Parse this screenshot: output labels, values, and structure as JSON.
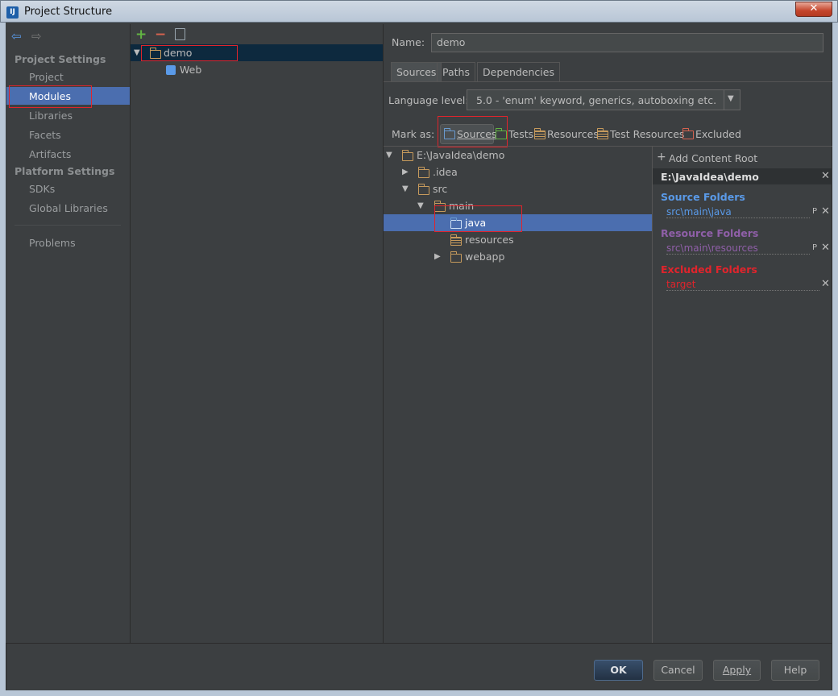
{
  "window": {
    "title": "Project Structure",
    "app_icon": "intellij-icon"
  },
  "sidebar": {
    "categories": [
      "Project Settings",
      "Platform Settings"
    ],
    "items": [
      "Project",
      "Modules",
      "Libraries",
      "Facets",
      "Artifacts",
      "SDKs",
      "Global Libraries",
      "Problems"
    ],
    "selected": "Modules"
  },
  "modules_tree": {
    "root": "demo",
    "child": "Web"
  },
  "name_field": {
    "label": "Name:",
    "value": "demo"
  },
  "tabs": [
    "Sources",
    "Paths",
    "Dependencies"
  ],
  "active_tab": "Sources",
  "language_level": {
    "label": "Language level:",
    "value": "5.0 - 'enum' keyword, generics, autoboxing etc."
  },
  "mark_as": {
    "label": "Mark as:",
    "options": [
      "Sources",
      "Tests",
      "Resources",
      "Test Resources",
      "Excluded"
    ]
  },
  "file_tree": {
    "root": "E:\\JavaIdea\\demo",
    "items": [
      ".idea",
      "src",
      "main",
      "java",
      "resources",
      "webapp"
    ],
    "selected": "java"
  },
  "content_root": {
    "add_label": "Add Content Root",
    "path": "E:\\JavaIdea\\demo",
    "source_title": "Source Folders",
    "source_path": "src\\main\\java",
    "resource_title": "Resource Folders",
    "resource_path": "src\\main\\resources",
    "excluded_title": "Excluded Folders",
    "excluded_path": "target",
    "p_label": "P"
  },
  "buttons": {
    "ok": "OK",
    "cancel": "Cancel",
    "apply": "Apply",
    "help": "Help"
  },
  "colors": {
    "selection": "#4b6eaf",
    "source": "#5a9ae8",
    "resource": "#8f5fa8",
    "excluded": "#e0242c",
    "highlight_box": "#e0242c"
  }
}
